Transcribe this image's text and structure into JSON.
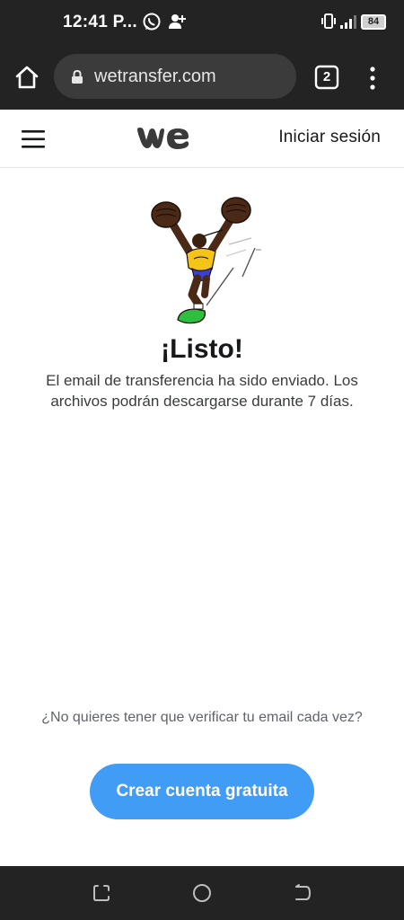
{
  "status_bar": {
    "time": "12:41 P...",
    "battery": "84",
    "icons": [
      "whatsapp-icon",
      "add-contact-icon",
      "vibrate-icon",
      "signal-icon",
      "battery-icon"
    ]
  },
  "browser": {
    "url": "wetransfer.com",
    "tab_count": "2",
    "icons": [
      "home-icon",
      "lock-icon",
      "tabs-icon",
      "more-vert-icon"
    ]
  },
  "header": {
    "signin_label": "Iniciar sesión",
    "icons": [
      "hamburger-icon",
      "wetransfer-logo"
    ]
  },
  "main": {
    "title": "¡Listo!",
    "message": "El email de transferencia ha sido enviado. Los archivos podrán descargarse durante 7 días.",
    "prompt": "¿No quieres tener que verificar tu email cada vez?",
    "cta_label": "Crear cuenta gratuita"
  },
  "nav_bar": {
    "icons": [
      "recents-icon",
      "home-circle-icon",
      "back-icon"
    ]
  },
  "colors": {
    "system_bar": "#232323",
    "url_field": "#3b3b3b",
    "cta": "#409cf5",
    "text": "#17181a",
    "muted_text": "#62636a"
  }
}
